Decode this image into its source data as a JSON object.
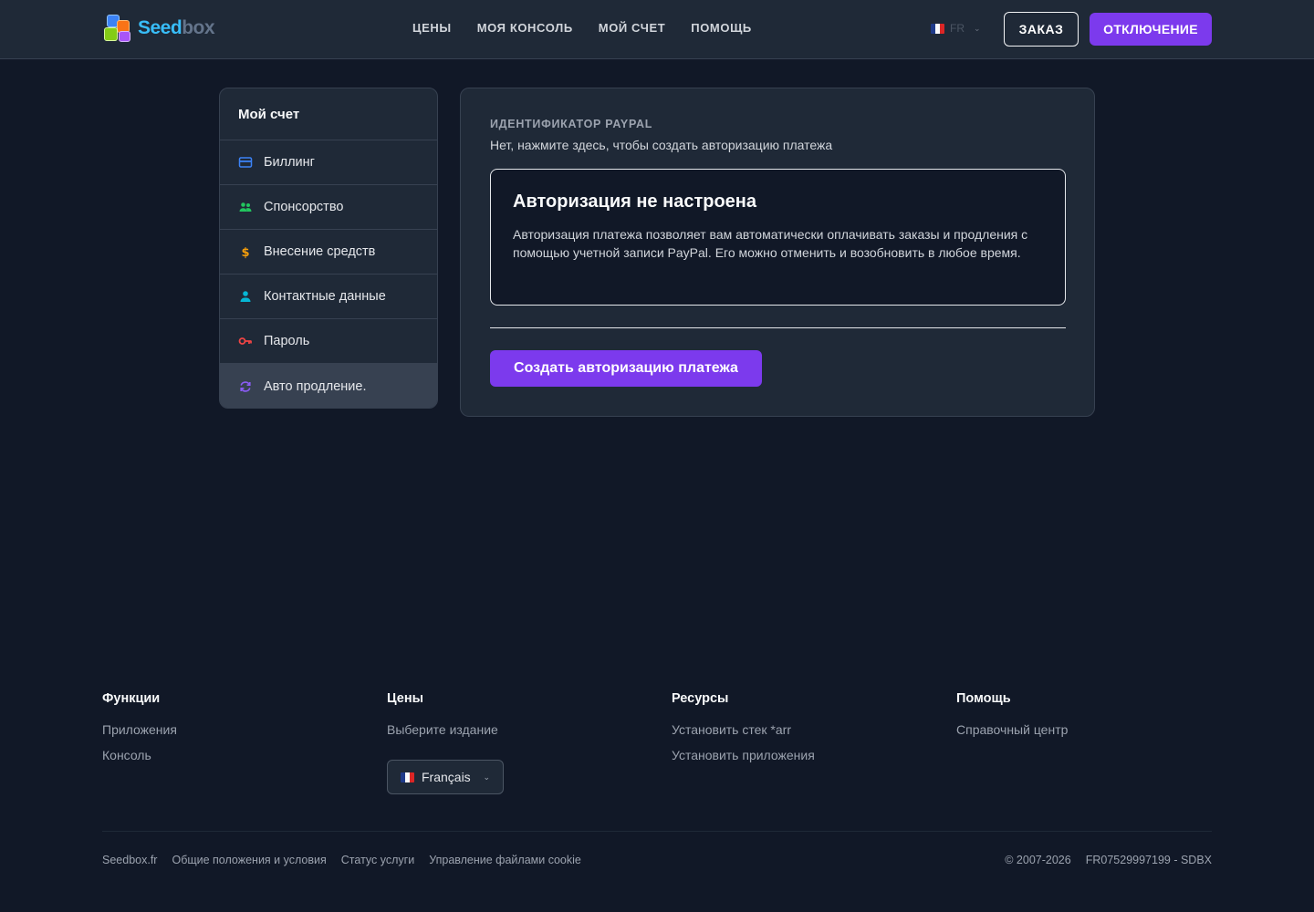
{
  "header": {
    "logo": {
      "text_main": "Seed",
      "text_dim": "box"
    },
    "nav": [
      "ЦЕНЫ",
      "МОЯ КОНСОЛЬ",
      "МОЙ СЧЕТ",
      "ПОМОЩЬ"
    ],
    "lang": "FR",
    "order_label": "ЗАКАЗ",
    "logout_label": "ОТКЛЮЧЕНИЕ"
  },
  "sidebar": {
    "title": "Мой счет",
    "items": [
      {
        "label": "Биллинг",
        "icon": "credit-card-icon",
        "color": "#3b82f6"
      },
      {
        "label": "Спонсорство",
        "icon": "users-icon",
        "color": "#22c55e"
      },
      {
        "label": "Внесение средств",
        "icon": "dollar-icon",
        "color": "#f59e0b"
      },
      {
        "label": "Контактные данные",
        "icon": "user-icon",
        "color": "#06b6d4"
      },
      {
        "label": "Пароль",
        "icon": "key-icon",
        "color": "#ef4444"
      },
      {
        "label": "Авто продление.",
        "icon": "refresh-icon",
        "color": "#8b5cf6",
        "active": true
      }
    ]
  },
  "panel": {
    "label": "ИДЕНТИФИКАТОР PAYPAL",
    "link": "Нет, нажмите здесь, чтобы создать авторизацию платежа",
    "notice_title": "Авторизация не настроена",
    "notice_body": "Авторизация платежа позволяет вам автоматически оплачивать заказы и продления с помощью учетной записи PayPal. Его можно отменить и возобновить в любое время.",
    "button": "Создать авторизацию платежа"
  },
  "footer": {
    "columns": [
      {
        "title": "Функции",
        "links": [
          "Приложения",
          "Консоль"
        ]
      },
      {
        "title": "Цены",
        "links": [
          "Выберите издание"
        ]
      },
      {
        "title": "Ресурсы",
        "links": [
          "Установить стек *arr",
          "Установить приложения"
        ]
      },
      {
        "title": "Помощь",
        "links": [
          "Справочный центр"
        ]
      }
    ],
    "language_select": "Français",
    "bottom_links": [
      "Seedbox.fr",
      "Общие положения и условия",
      "Статус услуги",
      "Управление файлами cookie"
    ],
    "copyright": "© 2007-2026",
    "company_id": "FR07529997199 - SDBX"
  },
  "colors": {
    "accent": "#7c3aed",
    "background": "#111827",
    "surface": "#1f2937"
  }
}
